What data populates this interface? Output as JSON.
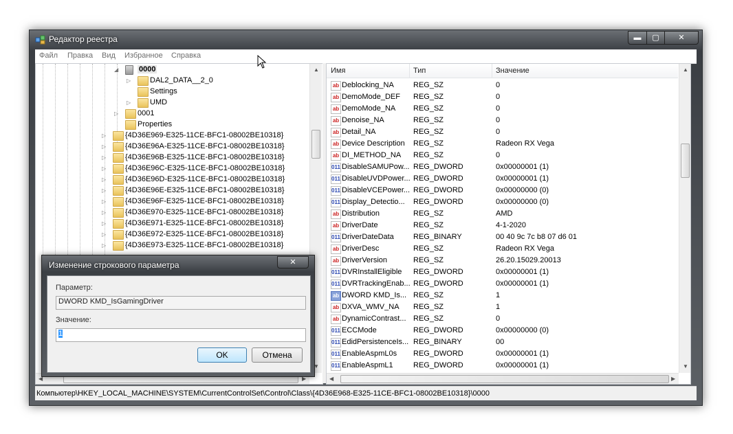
{
  "window": {
    "title": "Редактор реестра",
    "controls": {
      "minimize": "▬",
      "maximize": "▢",
      "close": "✕"
    }
  },
  "menu": [
    "Файл",
    "Правка",
    "Вид",
    "Избранное",
    "Справка"
  ],
  "tree": {
    "items": [
      {
        "label": "0000",
        "level": 1,
        "expanded": true,
        "selected": true,
        "bold": true
      },
      {
        "label": "DAL2_DATA__2_0",
        "level": 2,
        "has_children": true
      },
      {
        "label": "Settings",
        "level": 2,
        "has_children": false
      },
      {
        "label": "UMD",
        "level": 2,
        "has_children": true
      },
      {
        "label": "0001",
        "level": 1,
        "has_children": true
      },
      {
        "label": "Properties",
        "level": 1,
        "has_children": false
      },
      {
        "label": "{4D36E969-E325-11CE-BFC1-08002BE10318}",
        "level": 0,
        "has_children": true
      },
      {
        "label": "{4D36E96A-E325-11CE-BFC1-08002BE10318}",
        "level": 0,
        "has_children": true
      },
      {
        "label": "{4D36E96B-E325-11CE-BFC1-08002BE10318}",
        "level": 0,
        "has_children": true
      },
      {
        "label": "{4D36E96C-E325-11CE-BFC1-08002BE10318}",
        "level": 0,
        "has_children": true
      },
      {
        "label": "{4D36E96D-E325-11CE-BFC1-08002BE10318}",
        "level": 0,
        "has_children": true
      },
      {
        "label": "{4D36E96E-E325-11CE-BFC1-08002BE10318}",
        "level": 0,
        "has_children": true
      },
      {
        "label": "{4D36E96F-E325-11CE-BFC1-08002BE10318}",
        "level": 0,
        "has_children": true
      },
      {
        "label": "{4D36E970-E325-11CE-BFC1-08002BE10318}",
        "level": 0,
        "has_children": true
      },
      {
        "label": "{4D36E971-E325-11CE-BFC1-08002BE10318}",
        "level": 0,
        "has_children": true
      },
      {
        "label": "{4D36E972-E325-11CE-BFC1-08002BE10318}",
        "level": 0,
        "has_children": true
      },
      {
        "label": "{4D36E973-E325-11CE-BFC1-08002BE10318}",
        "level": 0,
        "has_children": true
      }
    ]
  },
  "list": {
    "columns": [
      "Имя",
      "Тип",
      "Значение"
    ],
    "rows": [
      {
        "icon": "ab",
        "name": "Deblocking_NA",
        "type": "REG_SZ",
        "value": "0"
      },
      {
        "icon": "ab",
        "name": "DemoMode_DEF",
        "type": "REG_SZ",
        "value": "0"
      },
      {
        "icon": "ab",
        "name": "DemoMode_NA",
        "type": "REG_SZ",
        "value": "0"
      },
      {
        "icon": "ab",
        "name": "Denoise_NA",
        "type": "REG_SZ",
        "value": "0"
      },
      {
        "icon": "ab",
        "name": "Detail_NA",
        "type": "REG_SZ",
        "value": "0"
      },
      {
        "icon": "ab",
        "name": "Device Description",
        "type": "REG_SZ",
        "value": "Radeon RX Vega"
      },
      {
        "icon": "ab",
        "name": "DI_METHOD_NA",
        "type": "REG_SZ",
        "value": "0"
      },
      {
        "icon": "bin",
        "name": "DisableSAMUPow...",
        "type": "REG_DWORD",
        "value": "0x00000001 (1)"
      },
      {
        "icon": "bin",
        "name": "DisableUVDPower...",
        "type": "REG_DWORD",
        "value": "0x00000001 (1)"
      },
      {
        "icon": "bin",
        "name": "DisableVCEPower...",
        "type": "REG_DWORD",
        "value": "0x00000000 (0)"
      },
      {
        "icon": "bin",
        "name": "Display_Detectio...",
        "type": "REG_DWORD",
        "value": "0x00000000 (0)"
      },
      {
        "icon": "ab",
        "name": "Distribution",
        "type": "REG_SZ",
        "value": "AMD"
      },
      {
        "icon": "ab",
        "name": "DriverDate",
        "type": "REG_SZ",
        "value": "4-1-2020"
      },
      {
        "icon": "bin",
        "name": "DriverDateData",
        "type": "REG_BINARY",
        "value": "00 40 9c 7c b8 07 d6 01"
      },
      {
        "icon": "ab",
        "name": "DriverDesc",
        "type": "REG_SZ",
        "value": "Radeon RX Vega"
      },
      {
        "icon": "ab",
        "name": "DriverVersion",
        "type": "REG_SZ",
        "value": "26.20.15029.20013"
      },
      {
        "icon": "bin",
        "name": "DVRInstallEligible",
        "type": "REG_DWORD",
        "value": "0x00000001 (1)"
      },
      {
        "icon": "bin",
        "name": "DVRTrackingEnab...",
        "type": "REG_DWORD",
        "value": "0x00000001 (1)"
      },
      {
        "icon": "ab-sel",
        "name": "DWORD KMD_Is...",
        "type": "REG_SZ",
        "value": "1"
      },
      {
        "icon": "ab",
        "name": "DXVA_WMV_NA",
        "type": "REG_SZ",
        "value": "1"
      },
      {
        "icon": "ab",
        "name": "DynamicContrast...",
        "type": "REG_SZ",
        "value": "0"
      },
      {
        "icon": "bin",
        "name": "ECCMode",
        "type": "REG_DWORD",
        "value": "0x00000000 (0)"
      },
      {
        "icon": "bin",
        "name": "EdidPersistenceIs...",
        "type": "REG_BINARY",
        "value": "00"
      },
      {
        "icon": "bin",
        "name": "EnableAspmL0s",
        "type": "REG_DWORD",
        "value": "0x00000001 (1)"
      },
      {
        "icon": "bin",
        "name": "EnableAspmL1",
        "type": "REG_DWORD",
        "value": "0x00000001 (1)"
      }
    ]
  },
  "status": "Компьютер\\HKEY_LOCAL_MACHINE\\SYSTEM\\CurrentControlSet\\Control\\Class\\{4D36E968-E325-11CE-BFC1-08002BE10318}\\0000",
  "dialog": {
    "title": "Изменение строкового параметра",
    "close": "✕",
    "param_label": "Параметр:",
    "param_value": "DWORD KMD_IsGamingDriver",
    "value_label": "Значение:",
    "value_value": "1",
    "ok_label": "OK",
    "cancel_label": "Отмена"
  },
  "colors": {
    "icon_string": "#cc2222",
    "icon_binary": "#2a46b0",
    "selection": "#3399ff"
  }
}
